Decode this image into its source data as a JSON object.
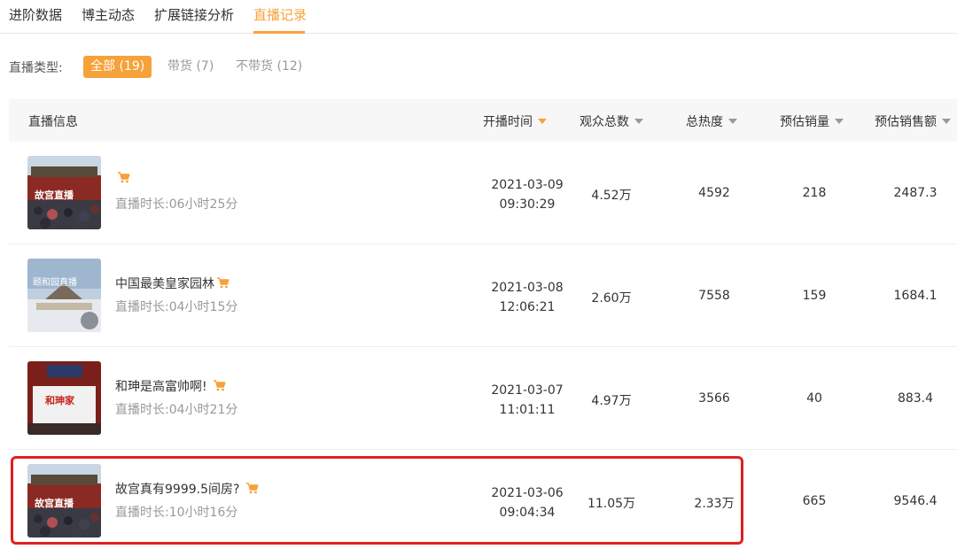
{
  "tabs": [
    {
      "label": "进阶数据",
      "active": false
    },
    {
      "label": "博主动态",
      "active": false
    },
    {
      "label": "扩展链接分析",
      "active": false
    },
    {
      "label": "直播记录",
      "active": true
    }
  ],
  "filter": {
    "label": "直播类型:",
    "options": [
      {
        "label": "全部 (19)",
        "active": true
      },
      {
        "label": "带货 (7)",
        "active": false
      },
      {
        "label": "不带货 (12)",
        "active": false
      }
    ]
  },
  "table": {
    "headers": {
      "info": "直播信息",
      "start_time": "开播时间",
      "viewers": "观众总数",
      "heat": "总热度",
      "est_sales": "预估销量",
      "est_revenue": "预估销售额"
    },
    "duration_label": "直播时长:",
    "rows": [
      {
        "title": "",
        "thumb_text": "故宫直播",
        "has_cart": true,
        "duration": "06小时25分",
        "date": "2021-03-09",
        "time": "09:30:29",
        "viewers": "4.52万",
        "heat": "4592",
        "sales": "218",
        "revenue": "2487.3"
      },
      {
        "title": "中国最美皇家园林",
        "thumb_text": "颐和园直播",
        "has_cart": true,
        "duration": "04小时15分",
        "date": "2021-03-08",
        "time": "12:06:21",
        "viewers": "2.60万",
        "heat": "7558",
        "sales": "159",
        "revenue": "1684.1"
      },
      {
        "title": "和珅是高富帅啊!",
        "thumb_text": "和珅家",
        "has_cart": true,
        "duration": "04小时21分",
        "date": "2021-03-07",
        "time": "11:01:11",
        "viewers": "4.97万",
        "heat": "3566",
        "sales": "40",
        "revenue": "883.4"
      },
      {
        "title": "故宫真有9999.5间房?",
        "thumb_text": "故宫直播",
        "has_cart": true,
        "duration": "10小时16分",
        "date": "2021-03-06",
        "time": "09:04:34",
        "viewers": "11.05万",
        "heat": "2.33万",
        "sales": "665",
        "revenue": "9546.4"
      }
    ]
  },
  "colors": {
    "accent": "#f7a13a",
    "highlight": "#e0201f"
  },
  "icons": {
    "cart": "shopping-cart-icon",
    "sort": "sort-desc-icon"
  }
}
